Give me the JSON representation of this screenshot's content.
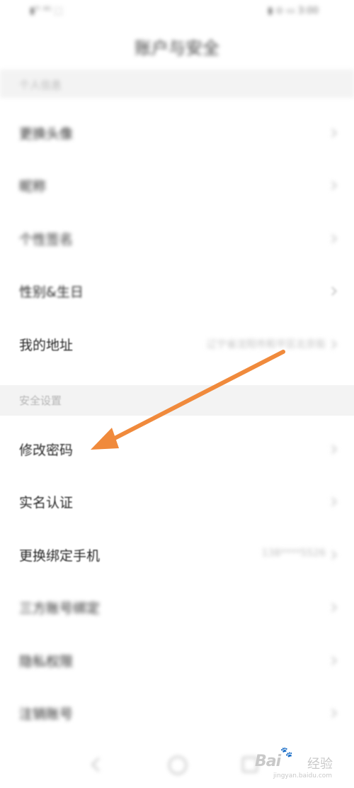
{
  "status_bar": {
    "left": "▮ᵀᴵ ⁴ᴳ ⬚",
    "right": "▮ ⊙ ▭ 3:00"
  },
  "header": {
    "title": "账户与安全"
  },
  "sections": [
    {
      "header": "个人信息",
      "items": [
        {
          "label": "更换头像",
          "value": ""
        },
        {
          "label": "昵称",
          "value": ""
        },
        {
          "label": "个性签名",
          "value": ""
        },
        {
          "label": "性别&生日",
          "value": ""
        },
        {
          "label": "我的地址",
          "value": "辽宁省沈阳市和平区北京街"
        }
      ]
    },
    {
      "header": "安全设置",
      "items": [
        {
          "label": "修改密码",
          "value": ""
        },
        {
          "label": "实名认证",
          "value": ""
        },
        {
          "label": "更换绑定手机",
          "value": "138****5526"
        },
        {
          "label": "三方账号绑定",
          "value": ""
        },
        {
          "label": "隐私权限",
          "value": ""
        },
        {
          "label": "注销账号",
          "value": ""
        }
      ]
    }
  ],
  "annotation": {
    "arrow_color": "#F08A3C",
    "points_to": "修改密码"
  },
  "watermark": {
    "logo": "Bai",
    "text": "经验",
    "url": "jingyan.baidu.com"
  }
}
